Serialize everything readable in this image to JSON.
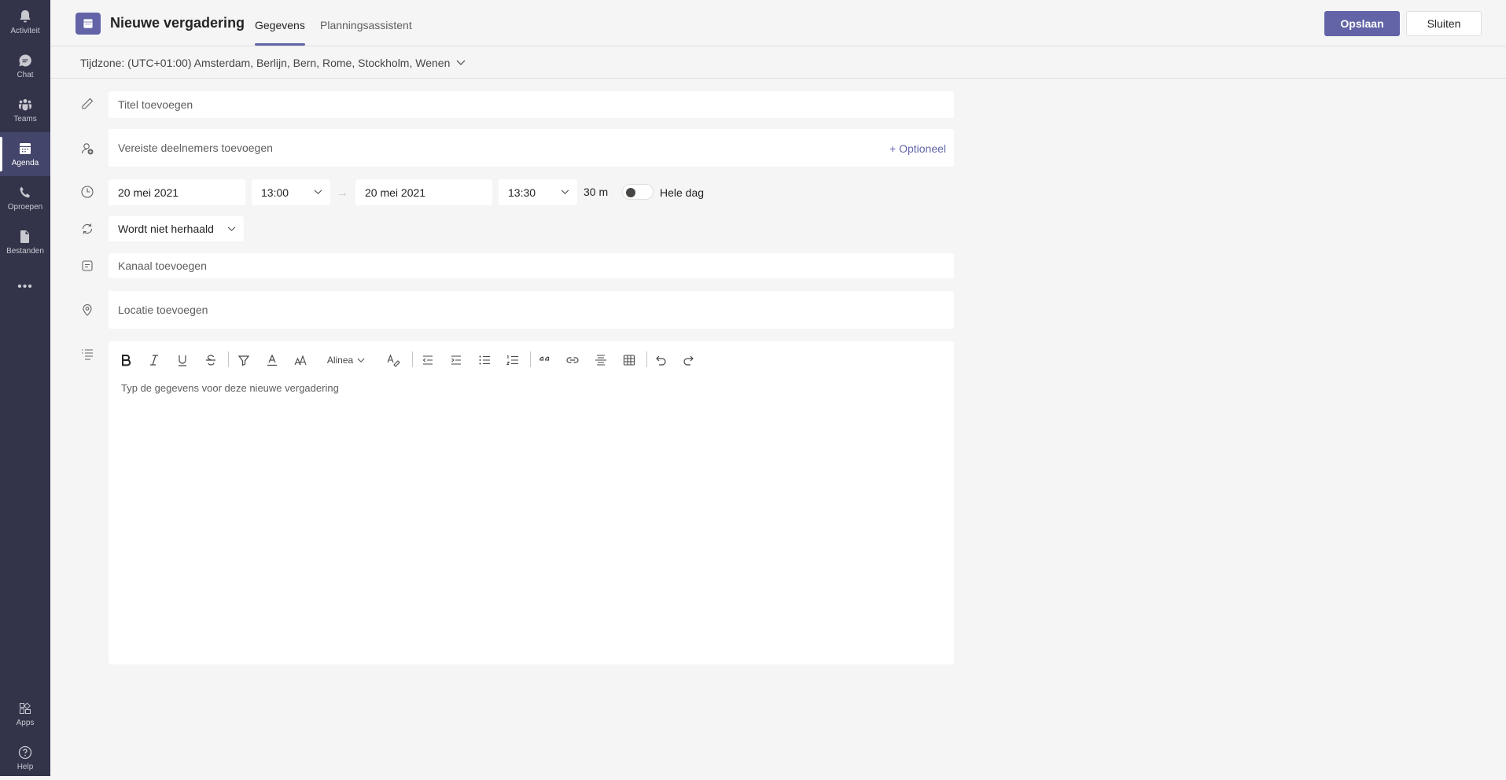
{
  "rail": {
    "items": [
      {
        "label": "Activiteit",
        "icon": "bell-icon"
      },
      {
        "label": "Chat",
        "icon": "chat-icon"
      },
      {
        "label": "Teams",
        "icon": "teams-icon"
      },
      {
        "label": "Agenda",
        "icon": "calendar-icon"
      },
      {
        "label": "Oproepen",
        "icon": "phone-icon"
      },
      {
        "label": "Bestanden",
        "icon": "file-icon"
      }
    ],
    "more_label": "•••",
    "apps_label": "Apps",
    "help_label": "Help"
  },
  "header": {
    "title": "Nieuwe vergadering",
    "tabs": [
      {
        "label": "Gegevens",
        "active": true
      },
      {
        "label": "Planningsassistent",
        "active": false
      }
    ],
    "save_label": "Opslaan",
    "close_label": "Sluiten"
  },
  "timezone": {
    "label": "Tijdzone: (UTC+01:00) Amsterdam, Berlijn, Bern, Rome, Stockholm, Wenen"
  },
  "form": {
    "title_placeholder": "Titel toevoegen",
    "attendees_placeholder": "Vereiste deelnemers toevoegen",
    "optional_label": "+ Optioneel",
    "start_date": "20 mei 2021",
    "start_time": "13:00",
    "arrow": "→",
    "end_date": "20 mei 2021",
    "end_time": "13:30",
    "duration": "30 m",
    "all_day_label": "Hele dag",
    "all_day_enabled": false,
    "repeat": "Wordt niet herhaald",
    "channel_placeholder": "Kanaal toevoegen",
    "location_placeholder": "Locatie toevoegen"
  },
  "editor": {
    "paragraph_label": "Alinea",
    "placeholder": "Typ de gegevens voor deze nieuwe vergadering"
  },
  "colors": {
    "accent": "#6264a7",
    "rail_bg": "#33344a",
    "page_bg": "#f5f5f5"
  }
}
